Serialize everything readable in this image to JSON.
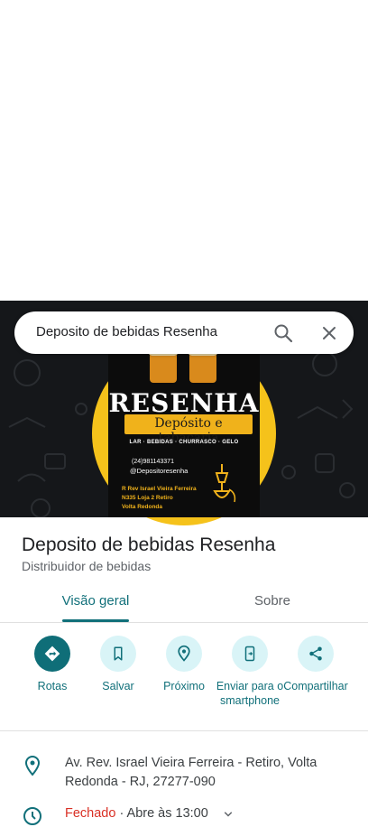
{
  "search": {
    "query": "Deposito de bebidas Resenha"
  },
  "photo": {
    "logo_title": "RESENHA",
    "logo_subtitle": "Depósito e tabacaria",
    "logo_tagline": "LAR · BEBIDAS · CHURRASCO · GELO",
    "logo_phone": "(24)981143371",
    "logo_instagram": "@Depositoresenha",
    "logo_address_1": "R Rev Israel Vieira Ferreira",
    "logo_address_2": "N335 Loja 2 Retiro",
    "logo_address_3": "Volta Redonda"
  },
  "place": {
    "title": "Deposito de bebidas Resenha",
    "category": "Distribuidor de bebidas"
  },
  "tabs": [
    {
      "label": "Visão geral",
      "active": true
    },
    {
      "label": "Sobre",
      "active": false
    }
  ],
  "actions": [
    {
      "label": "Rotas",
      "icon": "directions-icon"
    },
    {
      "label": "Salvar",
      "icon": "bookmark-icon"
    },
    {
      "label": "Próximo",
      "icon": "nearby-icon"
    },
    {
      "label": "Enviar para o smartphone",
      "icon": "send-to-phone-icon"
    },
    {
      "label": "Compartilhar",
      "icon": "share-icon"
    }
  ],
  "details": {
    "address": "Av. Rev. Israel Vieira Ferreira - Retiro, Volta Redonda - RJ, 27277-090",
    "hours_status": "Fechado",
    "hours_next": " · Abre às 13:00"
  },
  "colors": {
    "accent": "#11707a",
    "accent_bg": "#d9f4f7",
    "closed": "#d93025",
    "logo_yellow": "#f5c21b"
  }
}
